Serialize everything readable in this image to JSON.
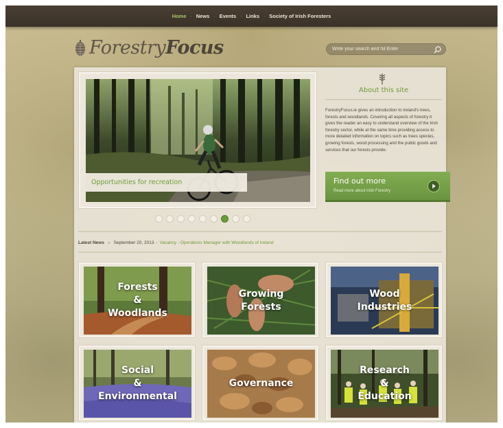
{
  "nav": {
    "items": [
      {
        "label": "Home",
        "active": true
      },
      {
        "label": "News",
        "active": false
      },
      {
        "label": "Events",
        "active": false
      },
      {
        "label": "Links",
        "active": false
      },
      {
        "label": "Society of Irish Foresters",
        "active": false
      }
    ]
  },
  "logo": {
    "part1": "Forestry",
    "part2": "Focus",
    "icon": "pine-cone-icon"
  },
  "search": {
    "placeholder": "Write your search and hit Enter",
    "icon": "search-icon"
  },
  "slider": {
    "caption": "Opportunities for recreation",
    "slide_count": 9,
    "active_slide": 7
  },
  "about": {
    "title": "About this site",
    "body": "ForestryFocus.ie  gives an introduction to Ireland's trees, forests and woodlands.  Covering all aspects of forestry  it gives the reader an easy to understand overview of the Irish forestry sector, while at the same time providing access to more detailed information on topics such as trees species, growing forests, wood processing and the public goods and services that our forests provide."
  },
  "cta": {
    "title": "Find out more",
    "subtitle": "Read more about Irish Forestry",
    "icon": "arrow-right-icon"
  },
  "news": {
    "label": "Latest News",
    "date": "September 20, 2013",
    "headline": "Vacancy - Operations Manager with Woodlands of Ireland"
  },
  "tiles": [
    {
      "label": "Forests\n&\nWoodlands"
    },
    {
      "label": "Growing\nForests"
    },
    {
      "label": "Wood\nIndustries"
    },
    {
      "label": "Social\n&\nEnvironmental"
    },
    {
      "label": "Governance"
    },
    {
      "label": "Research\n&\nEducation"
    }
  ],
  "colors": {
    "accent_green": "#6f9a3a",
    "nav_bg": "#3a3128",
    "panel_bg": "#ebe6da"
  }
}
